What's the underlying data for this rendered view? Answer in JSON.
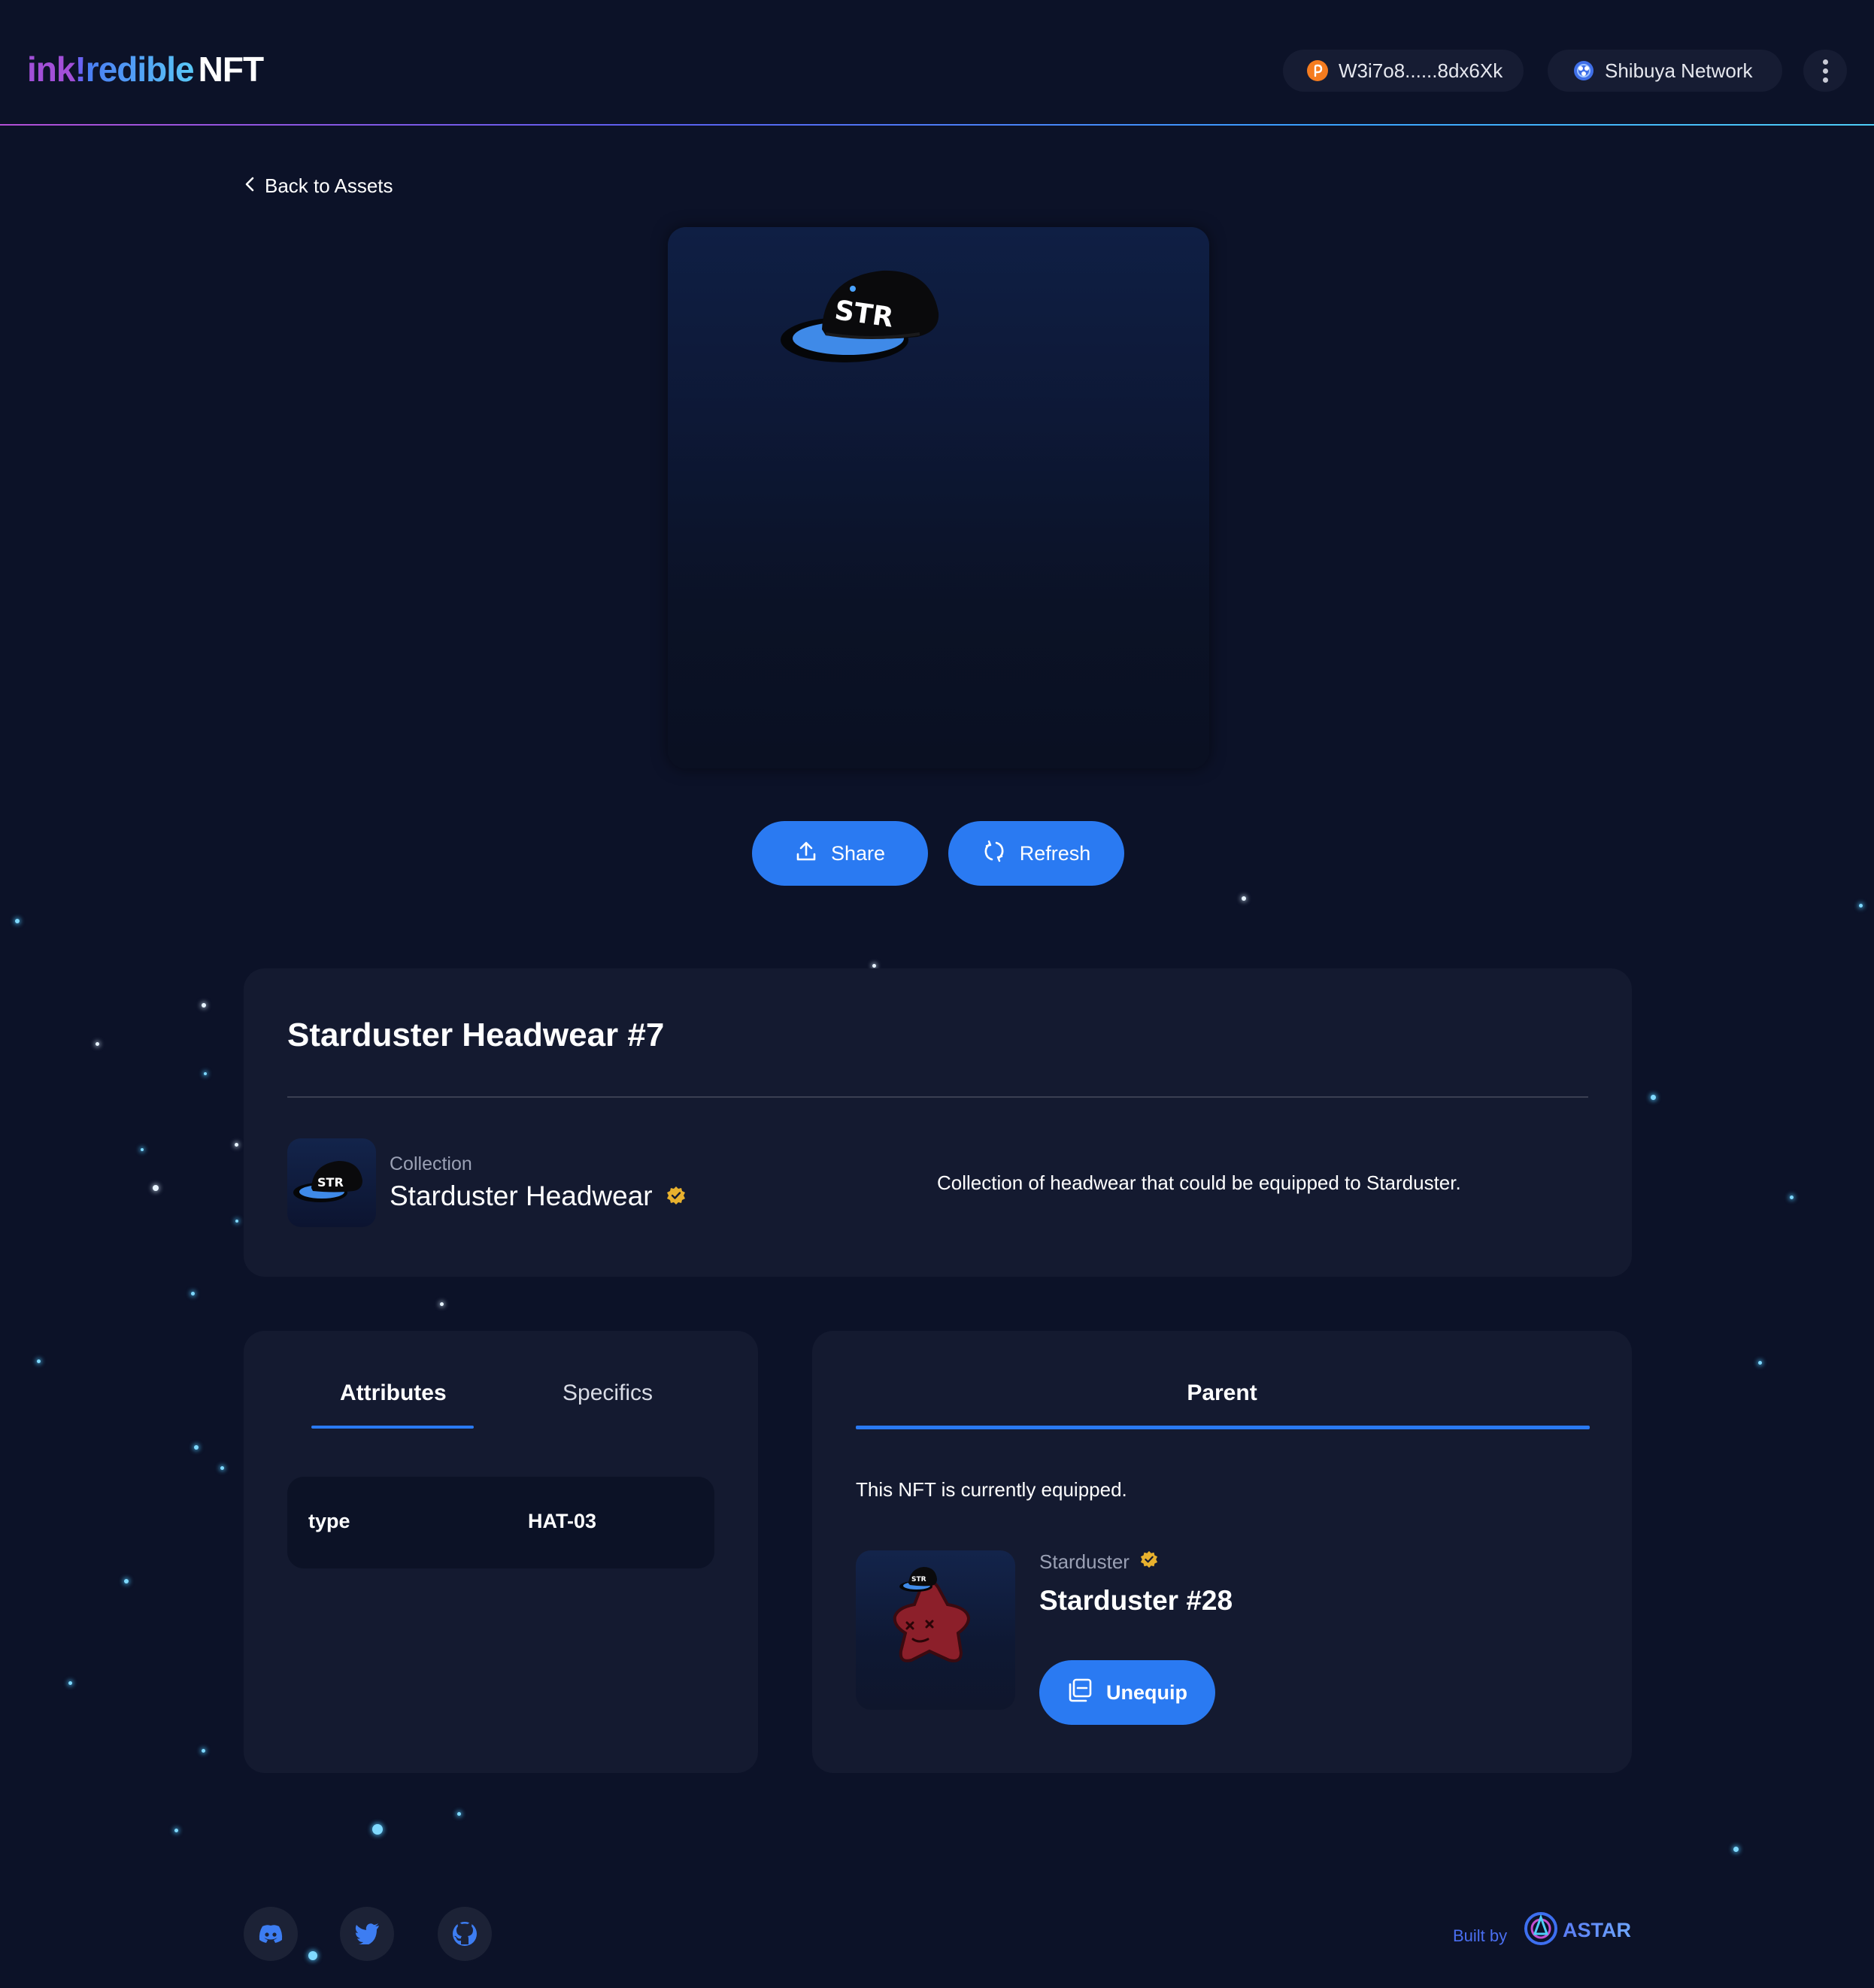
{
  "header": {
    "logo": {
      "part1": "ink",
      "part2": "!",
      "part3": "redible",
      "part4": "NFT"
    },
    "account": {
      "address": "W3i7o8......8dx6Xk",
      "icon": "polkadot-account-icon"
    },
    "network": {
      "label": "Shibuya Network",
      "icon": "shibuya-network-icon"
    },
    "menu_icon": "more-vertical-icon"
  },
  "navigation": {
    "back_label": "Back to Assets"
  },
  "actions": {
    "share_label": "Share",
    "refresh_label": "Refresh"
  },
  "nft": {
    "title": "Starduster Headwear #7",
    "collection_label": "Collection",
    "collection_name": "Starduster Headwear",
    "collection_description": "Collection of headwear that could be equipped to Starduster.",
    "verified_icon": "verified-badge-icon"
  },
  "attributes_panel": {
    "tabs": [
      {
        "label": "Attributes",
        "active": true
      },
      {
        "label": "Specifics",
        "active": false
      }
    ],
    "rows": [
      {
        "key": "type",
        "value": "HAT-03"
      }
    ]
  },
  "parent_panel": {
    "tab_label": "Parent",
    "note": "This NFT is currently equipped.",
    "parent_collection": "Starduster",
    "parent_name": "Starduster #28",
    "unequip_label": "Unequip"
  },
  "footer": {
    "socials": [
      "discord-icon",
      "twitter-icon",
      "github-icon"
    ],
    "built_by": "Built by",
    "brand": "ASTAR"
  },
  "colors": {
    "background": "#0c1228",
    "card": "#141a30",
    "accent": "#2a7af2",
    "verified": "#e8b12e"
  }
}
